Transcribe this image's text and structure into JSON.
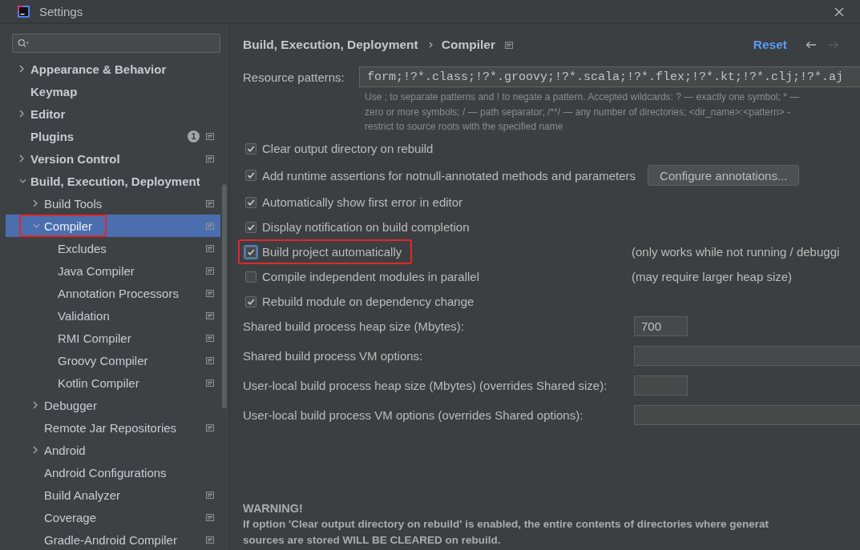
{
  "window": {
    "title": "Settings"
  },
  "sidebar": {
    "items": [
      {
        "label": "Appearance & Behavior",
        "expanded": false,
        "selected": false,
        "project_scope": false,
        "highlighted": false
      },
      {
        "label": "Keymap",
        "selected": false,
        "project_scope": false,
        "highlighted": false
      },
      {
        "label": "Editor",
        "expanded": false,
        "selected": false,
        "project_scope": false,
        "highlighted": false
      },
      {
        "label": "Plugins",
        "badge": "1",
        "selected": false,
        "project_scope": true,
        "highlighted": false
      },
      {
        "label": "Version Control",
        "expanded": false,
        "selected": false,
        "project_scope": true,
        "highlighted": false
      },
      {
        "label": "Build, Execution, Deployment",
        "expanded": true,
        "selected": false,
        "project_scope": false,
        "highlighted": false,
        "children": [
          {
            "label": "Build Tools",
            "expanded": false,
            "selected": false,
            "project_scope": true,
            "highlighted": false
          },
          {
            "label": "Compiler",
            "expanded": true,
            "selected": true,
            "project_scope": true,
            "highlighted": true,
            "children": [
              {
                "label": "Excludes",
                "selected": false,
                "project_scope": true,
                "highlighted": false
              },
              {
                "label": "Java Compiler",
                "selected": false,
                "project_scope": true,
                "highlighted": false
              },
              {
                "label": "Annotation Processors",
                "selected": false,
                "project_scope": true,
                "highlighted": false
              },
              {
                "label": "Validation",
                "selected": false,
                "project_scope": true,
                "highlighted": false
              },
              {
                "label": "RMI Compiler",
                "selected": false,
                "project_scope": true,
                "highlighted": false
              },
              {
                "label": "Groovy Compiler",
                "selected": false,
                "project_scope": true,
                "highlighted": false
              },
              {
                "label": "Kotlin Compiler",
                "selected": false,
                "project_scope": true,
                "highlighted": false
              }
            ]
          },
          {
            "label": "Debugger",
            "expanded": false,
            "selected": false,
            "project_scope": false,
            "highlighted": false
          },
          {
            "label": "Remote Jar Repositories",
            "selected": false,
            "project_scope": true,
            "highlighted": false
          },
          {
            "label": "Android",
            "expanded": false,
            "selected": false,
            "project_scope": false,
            "highlighted": false
          },
          {
            "label": "Android Configurations",
            "selected": false,
            "project_scope": false,
            "highlighted": false
          },
          {
            "label": "Build Analyzer",
            "selected": false,
            "project_scope": true,
            "highlighted": false
          },
          {
            "label": "Coverage",
            "selected": false,
            "project_scope": true,
            "highlighted": false
          },
          {
            "label": "Gradle-Android Compiler",
            "selected": false,
            "project_scope": true,
            "highlighted": false
          }
        ]
      }
    ]
  },
  "main": {
    "breadcrumb": [
      "Build, Execution, Deployment",
      "Compiler"
    ],
    "reset_link": "Reset",
    "nav": {
      "back_enabled": true,
      "forward_enabled": false
    },
    "resource_patterns": {
      "label": "Resource patterns:",
      "value": "form;!?*.class;!?*.groovy;!?*.scala;!?*.flex;!?*.kt;!?*.clj;!?*.aj",
      "help_lines": [
        "Use ; to separate patterns and ! to negate a pattern. Accepted wildcards: ? — exactly one symbol; * —",
        "zero or more symbols; / — path separator; /**/ — any number of directories; <dir_name>:<pattern> -",
        "restrict to source roots with the specified name"
      ]
    },
    "options": [
      {
        "label": "Clear output directory on rebuild",
        "checked": true,
        "focused": false,
        "highlighted": false
      },
      {
        "label": "Add runtime assertions for notnull-annotated methods and parameters",
        "checked": true,
        "focused": false,
        "highlighted": false,
        "button": "Configure annotations..."
      },
      {
        "label": "Automatically show first error in editor",
        "checked": true,
        "focused": false,
        "highlighted": false
      },
      {
        "label": "Display notification on build completion",
        "checked": true,
        "focused": false,
        "highlighted": false
      },
      {
        "label": "Build project automatically",
        "checked": true,
        "focused": true,
        "highlighted": true,
        "note": "(only works while not running / debuggi"
      },
      {
        "label": "Compile independent modules in parallel",
        "checked": false,
        "focused": false,
        "highlighted": false,
        "note": "(may require larger heap size)"
      },
      {
        "label": "Rebuild module on dependency change",
        "checked": true,
        "focused": false,
        "highlighted": false
      }
    ],
    "build_process": [
      {
        "label": "Shared build process heap size (Mbytes):",
        "kind": "short",
        "value": "700"
      },
      {
        "label": "Shared build process VM options:",
        "kind": "wide"
      },
      {
        "label": "User-local build process heap size (Mbytes) (overrides Shared size):",
        "kind": "short"
      },
      {
        "label": "User-local build process VM options (overrides Shared options):",
        "kind": "wide"
      }
    ],
    "warning": {
      "title": "WARNING!",
      "lines": [
        "If option 'Clear output directory on rebuild' is enabled, the entire contents of directories where generat",
        "sources are stored WILL BE CLEARED on rebuild."
      ]
    }
  }
}
